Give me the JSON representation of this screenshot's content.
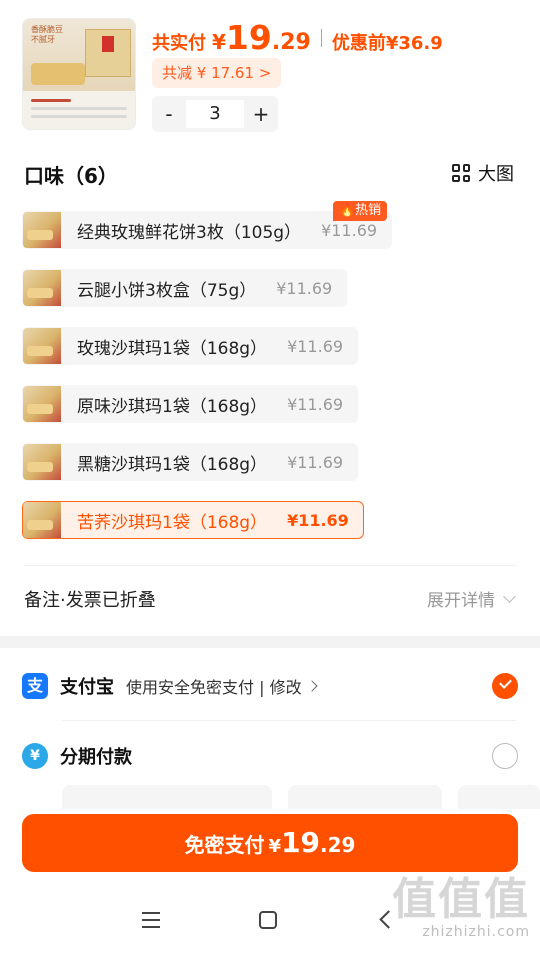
{
  "header": {
    "product_image_tag": "香酥脆豆 不腻牙",
    "paid_label": "共实付",
    "currency": "¥",
    "paid_int": "19",
    "paid_dec": ".29",
    "original_label": "优惠前",
    "original_price": "¥36.9",
    "discount_text": "共减 ¥ 17.61 >",
    "quantity": "3",
    "minus": "-",
    "plus": "+"
  },
  "flavor": {
    "title": "口味（6）",
    "bigview_label": "大图",
    "hot_badge": "🔥热销",
    "options": [
      {
        "name": "经典玫瑰鲜花饼3枚（105g）",
        "price": "¥11.69",
        "selected": false
      },
      {
        "name": "云腿小饼3枚盒（75g）",
        "price": "¥11.69",
        "selected": false
      },
      {
        "name": "玫瑰沙琪玛1袋（168g）",
        "price": "¥11.69",
        "selected": false
      },
      {
        "name": "原味沙琪玛1袋（168g）",
        "price": "¥11.69",
        "selected": false
      },
      {
        "name": "黑糖沙琪玛1袋（168g）",
        "price": "¥11.69",
        "selected": false
      },
      {
        "name": "苦荞沙琪玛1袋（168g）",
        "price": "¥11.69",
        "selected": true
      }
    ]
  },
  "remark": {
    "label": "备注·发票已折叠",
    "expand_label": "展开详情"
  },
  "payment": {
    "alipay_name": "支付宝",
    "alipay_icon_char": "支",
    "alipay_desc": "使用安全免密支付 | 修改",
    "installment_name": "分期付款",
    "installment_icon_char": "¥"
  },
  "cta": {
    "label": "免密支付",
    "currency": "¥",
    "int": "19",
    "dec": ".29"
  },
  "watermark": {
    "big": "值值值",
    "url": "zhizhizhi.com"
  },
  "colors": {
    "accent": "#ff5000",
    "alipay": "#1677ff"
  }
}
